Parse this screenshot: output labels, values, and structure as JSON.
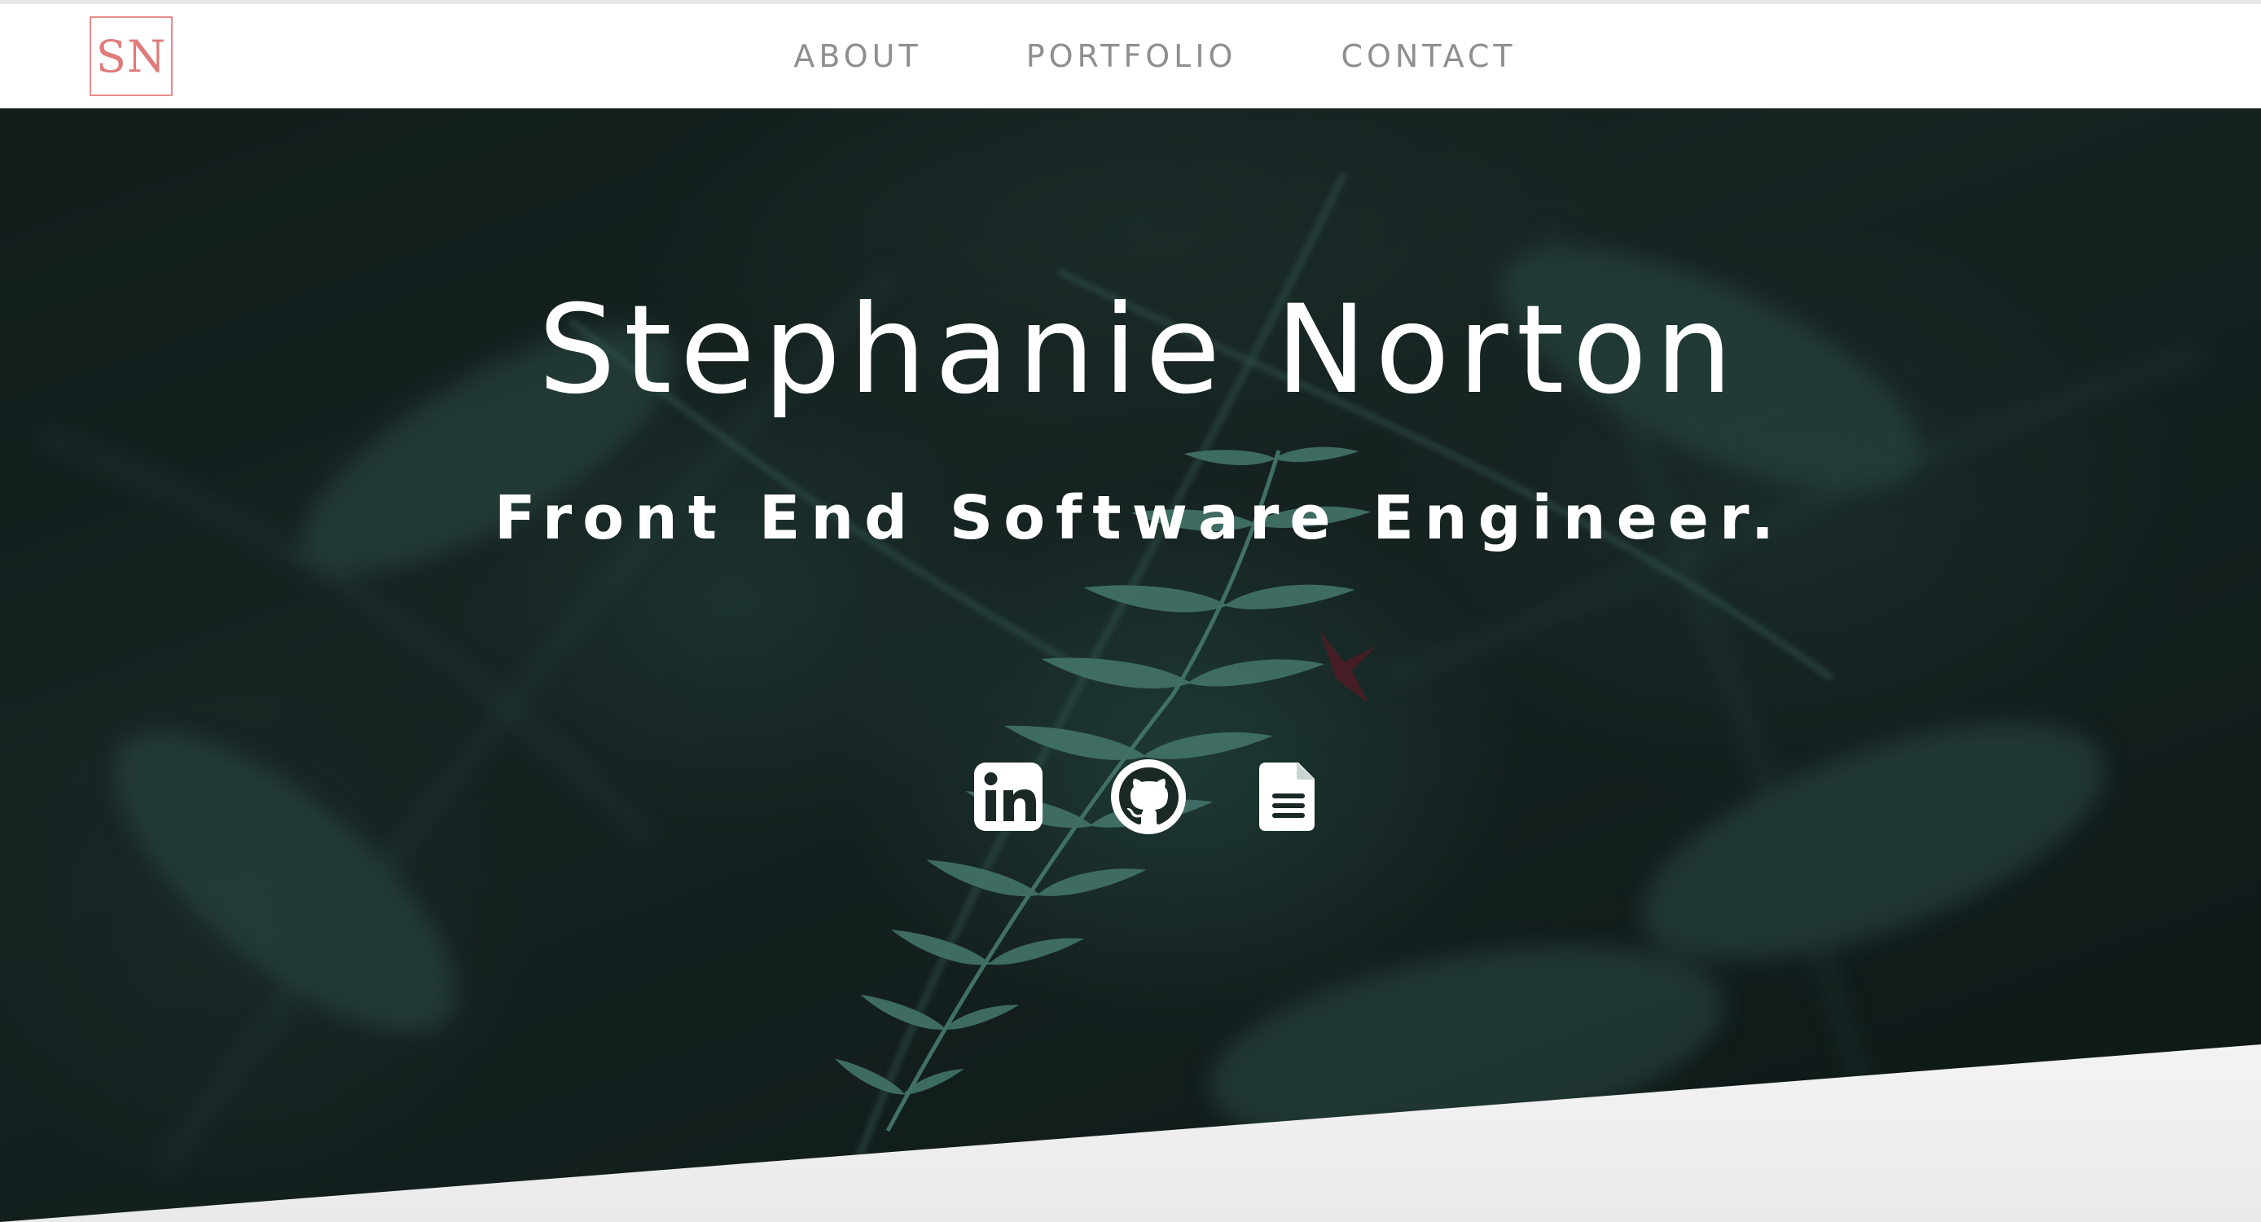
{
  "brand": {
    "logo_text": "SN",
    "accent_color": "#e07b7b"
  },
  "nav": {
    "items": [
      {
        "label": "ABOUT"
      },
      {
        "label": "PORTFOLIO"
      },
      {
        "label": "CONTACT"
      }
    ]
  },
  "hero": {
    "title": "Stephanie Norton",
    "subtitle": "Front End Software Engineer.",
    "background": "dark green fern foliage photo",
    "social_icons": [
      {
        "icon": "linkedin-icon"
      },
      {
        "icon": "github-icon"
      },
      {
        "icon": "document-icon"
      }
    ]
  }
}
